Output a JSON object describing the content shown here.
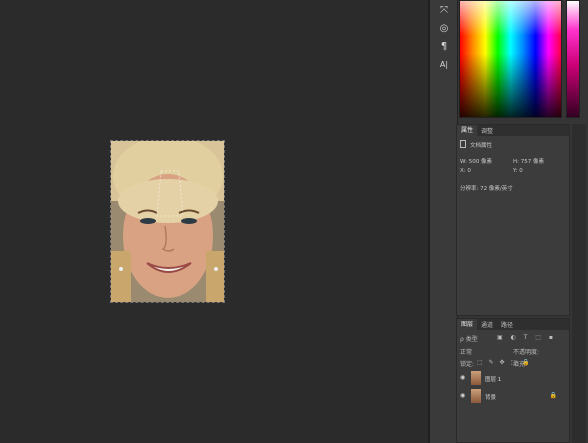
{
  "toolstrip": {
    "tools": [
      {
        "name": "transform-tool-icon",
        "glyph": "⤧"
      },
      {
        "name": "3d-tool-icon",
        "glyph": "◎"
      },
      {
        "name": "paragraph-tool-icon",
        "glyph": "¶"
      },
      {
        "name": "character-tool-icon",
        "glyph": "A|"
      }
    ]
  },
  "properties": {
    "tabs": [
      "属性",
      "调整"
    ],
    "doc_label": "文档属性",
    "w_label": "W:",
    "w_value": "500 像素",
    "h_label": "H:",
    "h_value": "757 像素",
    "x_label": "X:",
    "x_value": "0",
    "y_label": "Y:",
    "y_value": "0",
    "resolution": "分辨率: 72 像素/英寸"
  },
  "layers": {
    "tabs": [
      "图层",
      "通道",
      "路径"
    ],
    "kind_filter": "ρ 类型",
    "blend_mode": "正常",
    "opacity_label": "不透明度:",
    "lock_label": "锁定:",
    "fill_label": "填充:",
    "items": [
      {
        "name": "图层 1",
        "visible": true,
        "locked": false
      },
      {
        "name": "背景",
        "visible": true,
        "locked": true
      }
    ]
  }
}
